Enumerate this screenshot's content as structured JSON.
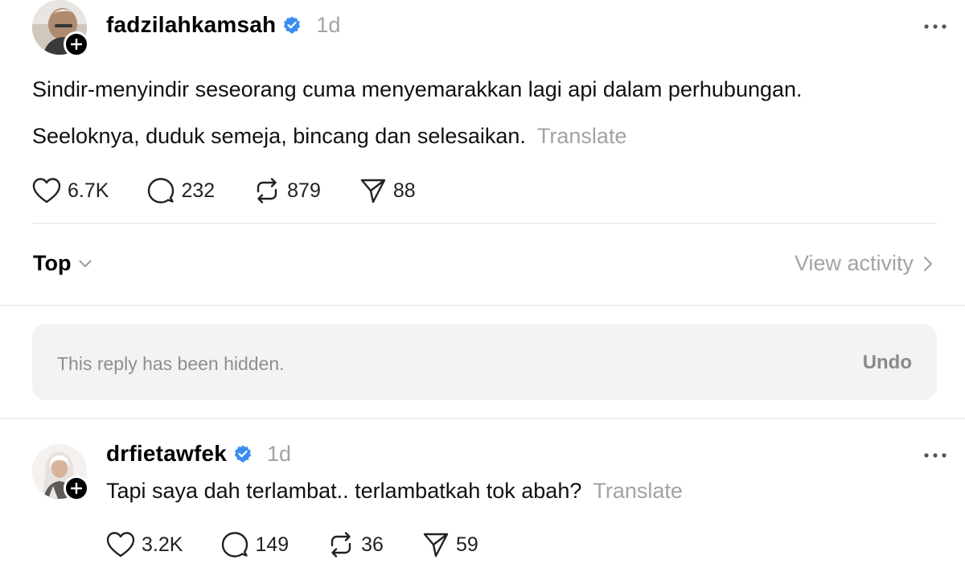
{
  "post": {
    "username": "fadzilahkamsah",
    "timestamp": "1d",
    "text_line1": "Sindir-menyindir seseorang cuma menyemarakkan lagi api dalam perhubungan.",
    "text_line2": "Seeloknya, duduk semeja, bincang dan selesaikan.",
    "translate": "Translate",
    "likes": "6.7K",
    "replies": "232",
    "reposts": "879",
    "shares": "88"
  },
  "replies_bar": {
    "sort_label": "Top",
    "view_activity": "View activity"
  },
  "hidden_reply": {
    "text": "This reply has been hidden.",
    "undo": "Undo"
  },
  "reply": {
    "username": "drfietawfek",
    "timestamp": "1d",
    "text": "Tapi saya dah terlambat.. terlambatkah tok abah?",
    "translate": "Translate",
    "likes": "3.2K",
    "replies": "149",
    "reposts": "36",
    "shares": "59"
  },
  "icons": [
    "heart-icon",
    "comment-icon",
    "repost-icon",
    "share-icon",
    "verified-icon",
    "more-icon",
    "plus-icon",
    "chevron-down-icon",
    "chevron-right-icon"
  ],
  "colors": {
    "verified": "#3b8df0",
    "muted": "#a3a3a3",
    "hidden_bg": "#f3f3f3"
  }
}
